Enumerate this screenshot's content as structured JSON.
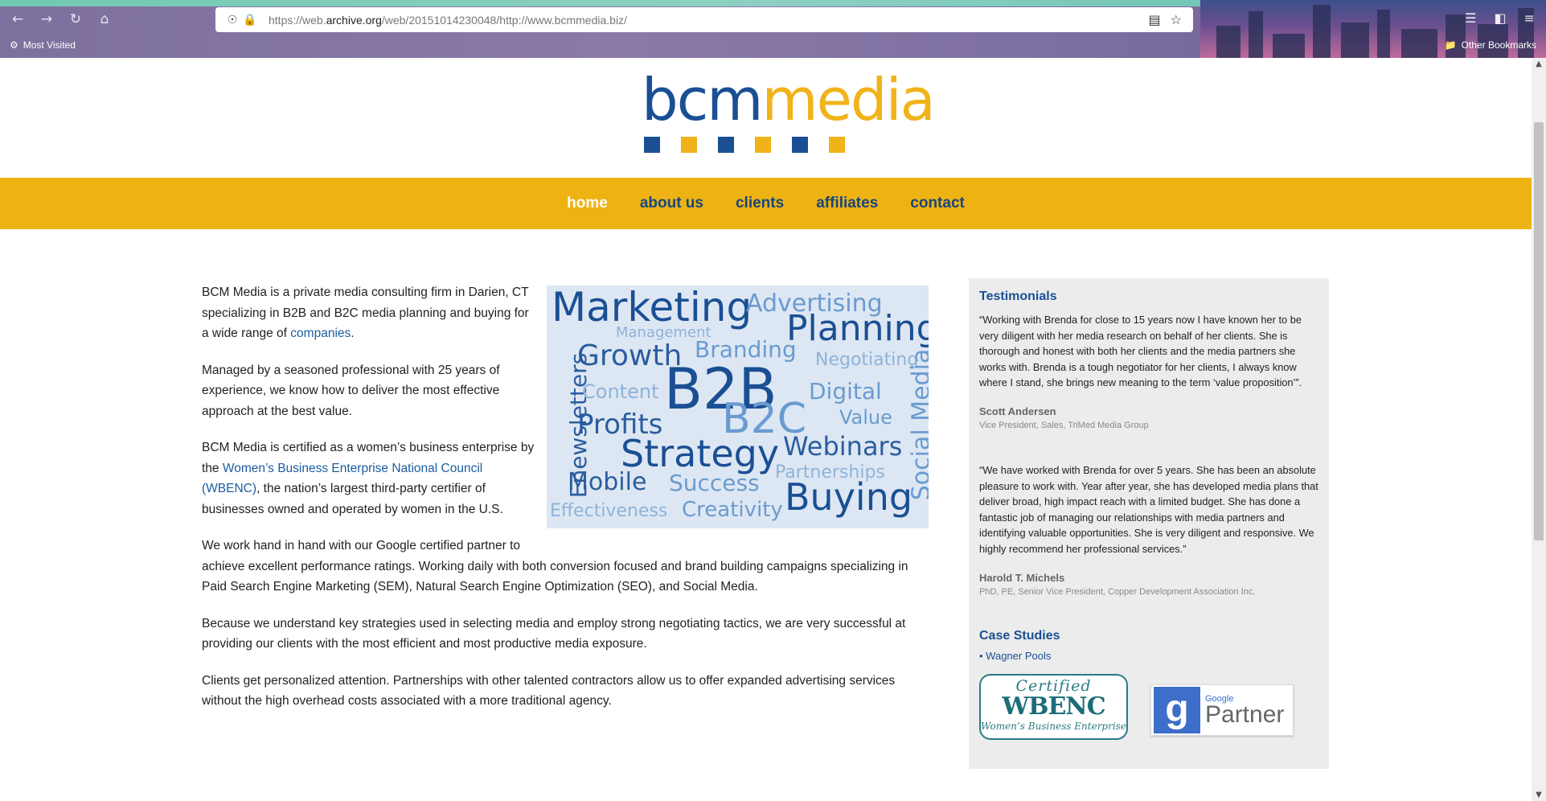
{
  "browser": {
    "url_prefix": "https://web.",
    "url_host": "archive.org",
    "url_rest": "/web/20151014230048/http://www.bcmmedia.biz/",
    "bookmark_most_visited": "Most Visited",
    "bookmark_other": "Other Bookmarks",
    "icons": [
      "back-icon",
      "forward-icon",
      "reload-icon",
      "home-icon",
      "shield-icon",
      "lock-icon",
      "reader-icon",
      "star-icon",
      "library-icon",
      "sidebar-icon",
      "menu-icon"
    ]
  },
  "logo": {
    "part1": "bcm",
    "part2": "media"
  },
  "colors": {
    "brand_blue": "#1a4f94",
    "brand_gold": "#eeb313",
    "link": "#1c5c9e"
  },
  "nav": {
    "items": [
      {
        "label": "home"
      },
      {
        "label": "about us"
      },
      {
        "label": "clients"
      },
      {
        "label": "affiliates"
      },
      {
        "label": "contact"
      }
    ],
    "active": "home"
  },
  "main": {
    "p1_text": "BCM Media is a private media consulting firm in Darien, CT specializing in B2B and B2C media planning and buying for a wide range of ",
    "p1_link": "companies",
    "p1_end": ".",
    "p2": "Managed by a seasoned professional with 25 years of experience, we know how to deliver the most effective approach at the best value.",
    "p3_start": "BCM Media is certified as a women’s business enterprise by the ",
    "p3_link": "Women’s Business Enterprise National Council (WBENC)",
    "p3_end": ", the nation’s largest third-party certifier of businesses owned and operated by women in the U.S.",
    "p4_line1": "We work hand in hand with our Google certified partner to",
    "p4_rest": "achieve excellent performance ratings. Working daily with both conversion focused and brand building campaigns specializing in Paid Search Engine Marketing (SEM), Natural Search Engine Optimization (SEO), and Social Media.",
    "p5": "Because we understand key strategies used in selecting media and employ strong negotiating tactics, we are very successful at providing our clients with the most efficient and most productive media exposure.",
    "p6": "Clients get personalized attention. Partnerships with other talented contractors allow us to offer expanded advertising services without the high overhead costs associated with a more traditional agency."
  },
  "word_cloud": {
    "words": [
      "Marketing",
      "Advertising",
      "Management",
      "Planning",
      "Growth",
      "Branding",
      "Negotiating",
      "Enewsletters",
      "Content",
      "B2B",
      "Digital",
      "B2C",
      "Value",
      "Social Media",
      "Profits",
      "Strategy",
      "Webinars",
      "Mobile",
      "Success",
      "Partnerships",
      "Buying",
      "Effectiveness",
      "Creativity"
    ]
  },
  "sidebar": {
    "testimonials_title": "Testimonials",
    "testimonials": [
      {
        "quote": "“Working with Brenda for close to 15 years now I have known her to be very diligent with her media research on behalf of her clients. She is thorough and honest with both her clients and the media partners she works with. Brenda is a tough negotiator for her clients, I always know where I stand, she brings new meaning to the term ‘value proposition’”.",
        "name": "Scott Andersen",
        "role": "Vice President, Sales, TriMed Media Group"
      },
      {
        "quote": "“We have worked with Brenda for over 5 years. She has been an absolute pleasure to work with. Year after year, she has developed media plans that deliver broad, high impact reach with a limited budget. She has done a fantastic job of managing our relationships with media partners and identifying valuable opportunities. She is very diligent and responsive. We highly recommend her professional services.”",
        "name": "Harold T. Michels",
        "role": "PhD, PE, Senior Vice President, Copper Development Association Inc."
      }
    ],
    "case_studies_title": "Case Studies",
    "case_studies": [
      "Wagner Pools"
    ],
    "wbenc_badge": {
      "line1": "Certified",
      "line2": "WBENC",
      "line3": "Women’s Business Enterprise"
    },
    "google_badge": {
      "letter": "g",
      "line1": "Google",
      "line2": "Partner"
    }
  }
}
